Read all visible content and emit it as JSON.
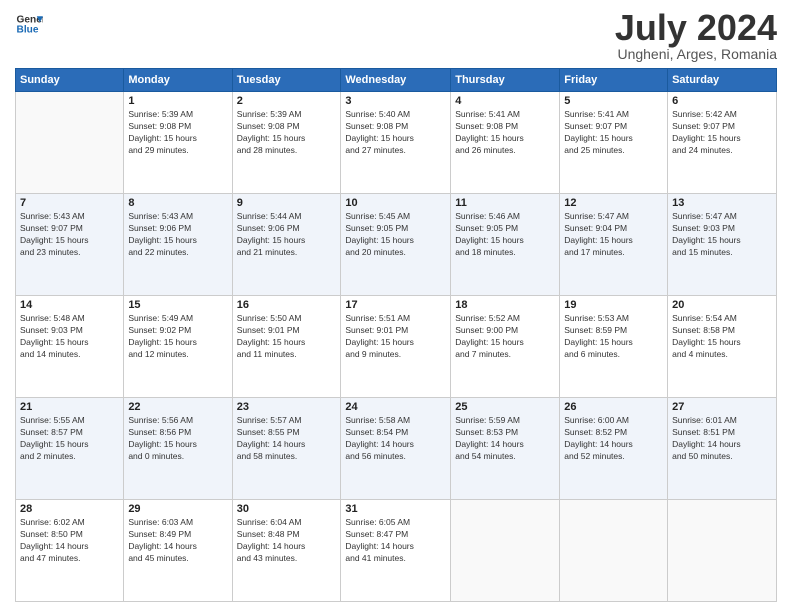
{
  "logo": {
    "line1": "General",
    "line2": "Blue"
  },
  "title": "July 2024",
  "subtitle": "Ungheni, Arges, Romania",
  "days_of_week": [
    "Sunday",
    "Monday",
    "Tuesday",
    "Wednesday",
    "Thursday",
    "Friday",
    "Saturday"
  ],
  "weeks": [
    [
      {
        "day": "",
        "info": ""
      },
      {
        "day": "1",
        "info": "Sunrise: 5:39 AM\nSunset: 9:08 PM\nDaylight: 15 hours\nand 29 minutes."
      },
      {
        "day": "2",
        "info": "Sunrise: 5:39 AM\nSunset: 9:08 PM\nDaylight: 15 hours\nand 28 minutes."
      },
      {
        "day": "3",
        "info": "Sunrise: 5:40 AM\nSunset: 9:08 PM\nDaylight: 15 hours\nand 27 minutes."
      },
      {
        "day": "4",
        "info": "Sunrise: 5:41 AM\nSunset: 9:08 PM\nDaylight: 15 hours\nand 26 minutes."
      },
      {
        "day": "5",
        "info": "Sunrise: 5:41 AM\nSunset: 9:07 PM\nDaylight: 15 hours\nand 25 minutes."
      },
      {
        "day": "6",
        "info": "Sunrise: 5:42 AM\nSunset: 9:07 PM\nDaylight: 15 hours\nand 24 minutes."
      }
    ],
    [
      {
        "day": "7",
        "info": "Sunrise: 5:43 AM\nSunset: 9:07 PM\nDaylight: 15 hours\nand 23 minutes."
      },
      {
        "day": "8",
        "info": "Sunrise: 5:43 AM\nSunset: 9:06 PM\nDaylight: 15 hours\nand 22 minutes."
      },
      {
        "day": "9",
        "info": "Sunrise: 5:44 AM\nSunset: 9:06 PM\nDaylight: 15 hours\nand 21 minutes."
      },
      {
        "day": "10",
        "info": "Sunrise: 5:45 AM\nSunset: 9:05 PM\nDaylight: 15 hours\nand 20 minutes."
      },
      {
        "day": "11",
        "info": "Sunrise: 5:46 AM\nSunset: 9:05 PM\nDaylight: 15 hours\nand 18 minutes."
      },
      {
        "day": "12",
        "info": "Sunrise: 5:47 AM\nSunset: 9:04 PM\nDaylight: 15 hours\nand 17 minutes."
      },
      {
        "day": "13",
        "info": "Sunrise: 5:47 AM\nSunset: 9:03 PM\nDaylight: 15 hours\nand 15 minutes."
      }
    ],
    [
      {
        "day": "14",
        "info": "Sunrise: 5:48 AM\nSunset: 9:03 PM\nDaylight: 15 hours\nand 14 minutes."
      },
      {
        "day": "15",
        "info": "Sunrise: 5:49 AM\nSunset: 9:02 PM\nDaylight: 15 hours\nand 12 minutes."
      },
      {
        "day": "16",
        "info": "Sunrise: 5:50 AM\nSunset: 9:01 PM\nDaylight: 15 hours\nand 11 minutes."
      },
      {
        "day": "17",
        "info": "Sunrise: 5:51 AM\nSunset: 9:01 PM\nDaylight: 15 hours\nand 9 minutes."
      },
      {
        "day": "18",
        "info": "Sunrise: 5:52 AM\nSunset: 9:00 PM\nDaylight: 15 hours\nand 7 minutes."
      },
      {
        "day": "19",
        "info": "Sunrise: 5:53 AM\nSunset: 8:59 PM\nDaylight: 15 hours\nand 6 minutes."
      },
      {
        "day": "20",
        "info": "Sunrise: 5:54 AM\nSunset: 8:58 PM\nDaylight: 15 hours\nand 4 minutes."
      }
    ],
    [
      {
        "day": "21",
        "info": "Sunrise: 5:55 AM\nSunset: 8:57 PM\nDaylight: 15 hours\nand 2 minutes."
      },
      {
        "day": "22",
        "info": "Sunrise: 5:56 AM\nSunset: 8:56 PM\nDaylight: 15 hours\nand 0 minutes."
      },
      {
        "day": "23",
        "info": "Sunrise: 5:57 AM\nSunset: 8:55 PM\nDaylight: 14 hours\nand 58 minutes."
      },
      {
        "day": "24",
        "info": "Sunrise: 5:58 AM\nSunset: 8:54 PM\nDaylight: 14 hours\nand 56 minutes."
      },
      {
        "day": "25",
        "info": "Sunrise: 5:59 AM\nSunset: 8:53 PM\nDaylight: 14 hours\nand 54 minutes."
      },
      {
        "day": "26",
        "info": "Sunrise: 6:00 AM\nSunset: 8:52 PM\nDaylight: 14 hours\nand 52 minutes."
      },
      {
        "day": "27",
        "info": "Sunrise: 6:01 AM\nSunset: 8:51 PM\nDaylight: 14 hours\nand 50 minutes."
      }
    ],
    [
      {
        "day": "28",
        "info": "Sunrise: 6:02 AM\nSunset: 8:50 PM\nDaylight: 14 hours\nand 47 minutes."
      },
      {
        "day": "29",
        "info": "Sunrise: 6:03 AM\nSunset: 8:49 PM\nDaylight: 14 hours\nand 45 minutes."
      },
      {
        "day": "30",
        "info": "Sunrise: 6:04 AM\nSunset: 8:48 PM\nDaylight: 14 hours\nand 43 minutes."
      },
      {
        "day": "31",
        "info": "Sunrise: 6:05 AM\nSunset: 8:47 PM\nDaylight: 14 hours\nand 41 minutes."
      },
      {
        "day": "",
        "info": ""
      },
      {
        "day": "",
        "info": ""
      },
      {
        "day": "",
        "info": ""
      }
    ]
  ]
}
